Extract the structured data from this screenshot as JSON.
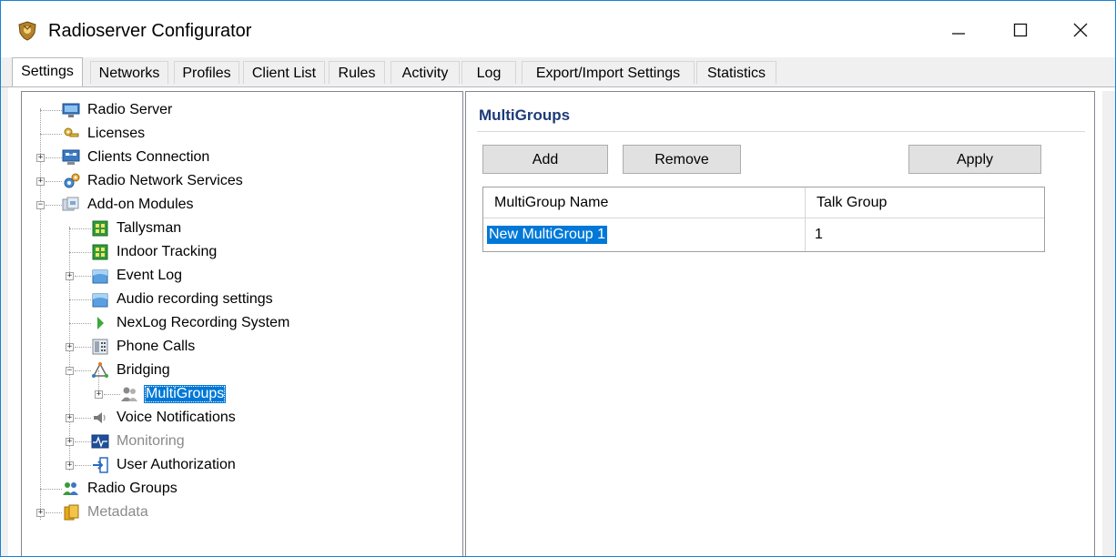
{
  "window": {
    "title": "Radioserver Configurator",
    "controls": {
      "minimize": "—",
      "maximize": "☐",
      "close": "✕"
    }
  },
  "tabs": [
    {
      "label": "Settings",
      "active": true
    },
    {
      "label": "Networks"
    },
    {
      "label": "Profiles"
    },
    {
      "label": "Client List"
    },
    {
      "label": "Rules"
    },
    {
      "label": "Activity"
    },
    {
      "label": "Log"
    },
    {
      "label": "Export/Import Settings"
    },
    {
      "label": "Statistics"
    }
  ],
  "tree": {
    "items": [
      {
        "label": "Radio Server",
        "icon": "monitor-icon"
      },
      {
        "label": "Licenses",
        "icon": "key-icon"
      },
      {
        "label": "Clients Connection",
        "icon": "network-computers-icon"
      },
      {
        "label": "Radio Network Services",
        "icon": "gears-icon"
      },
      {
        "label": "Add-on Modules",
        "icon": "modules-icon"
      },
      {
        "label": "Tallysman",
        "icon": "circuit-board-icon"
      },
      {
        "label": "Indoor Tracking",
        "icon": "circuit-board-icon"
      },
      {
        "label": "Event Log",
        "icon": "event-log-icon"
      },
      {
        "label": "Audio recording settings",
        "icon": "audio-settings-icon"
      },
      {
        "label": "NexLog Recording System",
        "icon": "green-arrow-icon"
      },
      {
        "label": "Phone Calls",
        "icon": "phone-icon"
      },
      {
        "label": "Bridging",
        "icon": "bridge-icon"
      },
      {
        "label": "MultiGroups",
        "icon": "users-group-icon",
        "selected": true
      },
      {
        "label": "Voice Notifications",
        "icon": "speaker-icon"
      },
      {
        "label": "Monitoring",
        "icon": "monitoring-icon",
        "disabled": true
      },
      {
        "label": "User Authorization",
        "icon": "login-arrow-icon"
      },
      {
        "label": "Radio Groups",
        "icon": "people-icon"
      },
      {
        "label": "Metadata",
        "icon": "database-icon",
        "disabled": true
      }
    ]
  },
  "detail": {
    "title": "MultiGroups",
    "buttons": {
      "add": "Add",
      "remove": "Remove",
      "apply": "Apply"
    },
    "table": {
      "columns": [
        "MultiGroup Name",
        "Talk Group"
      ],
      "rows": [
        {
          "name": "New MultiGroup 1",
          "talk_group": "1"
        }
      ]
    }
  },
  "colors": {
    "selection": "#0078d7",
    "window_border": "#1883d7",
    "title_accent": "#1e3b78"
  }
}
